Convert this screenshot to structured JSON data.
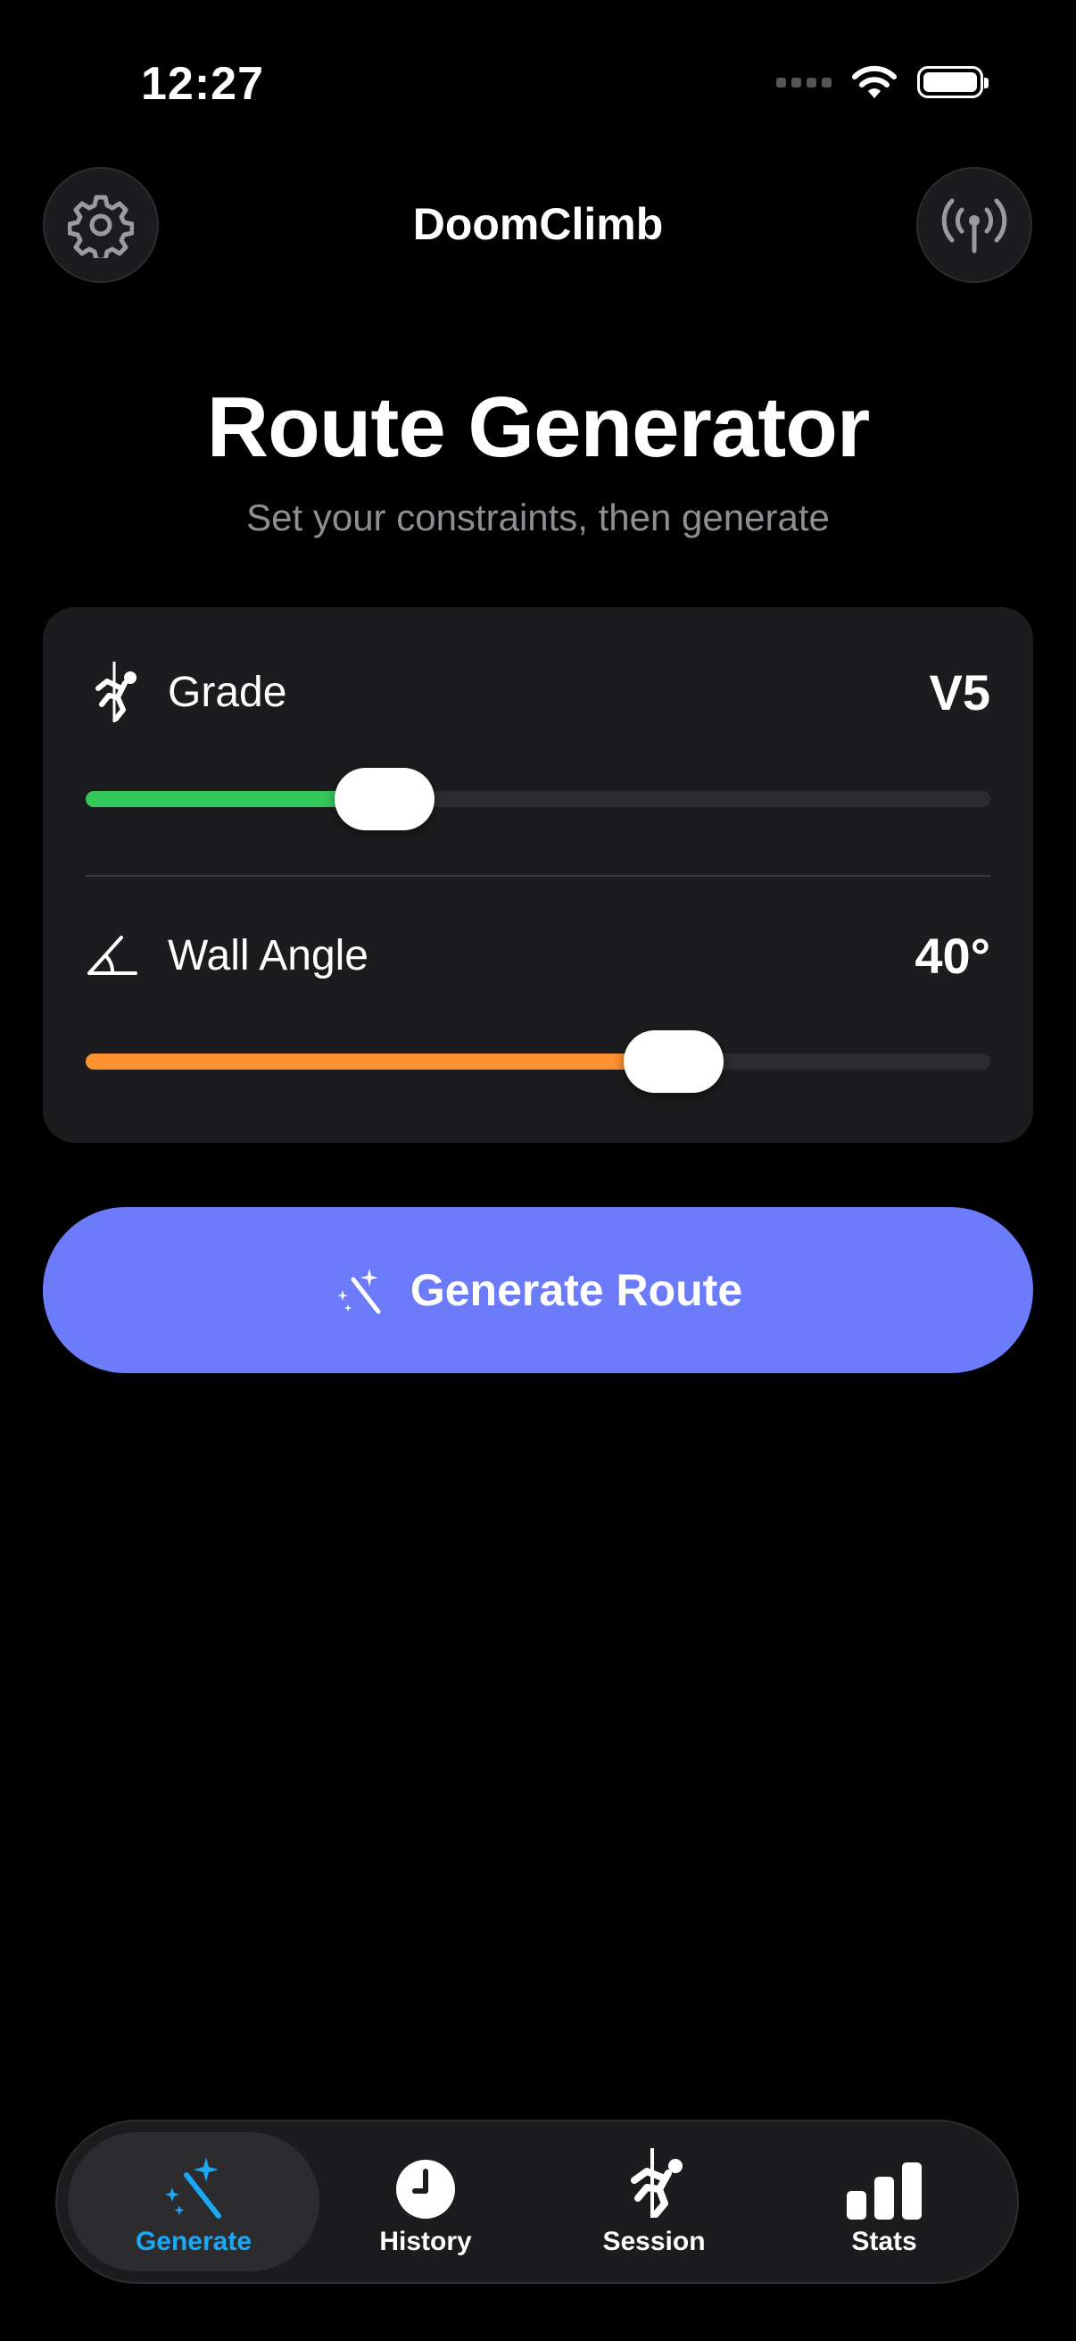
{
  "status_bar": {
    "time": "12:27"
  },
  "header": {
    "app_title": "DoomClimb",
    "settings_icon": "gear-icon",
    "live_icon": "antenna-icon"
  },
  "page": {
    "title": "Route Generator",
    "subtitle": "Set your constraints, then generate"
  },
  "constraints": {
    "grade": {
      "label": "Grade",
      "value": "V5",
      "slider_fraction": 0.33,
      "color": "#34c759"
    },
    "wall_angle": {
      "label": "Wall Angle",
      "value": "40°",
      "slider_fraction": 0.65,
      "color": "#ff9230"
    }
  },
  "generate_button": {
    "label": "Generate Route",
    "color": "#6b7bfa"
  },
  "tabs": [
    {
      "label": "Generate",
      "icon": "magic-wand-icon",
      "active": true
    },
    {
      "label": "History",
      "icon": "clock-icon",
      "active": false
    },
    {
      "label": "Session",
      "icon": "climber-icon",
      "active": false
    },
    {
      "label": "Stats",
      "icon": "bar-chart-icon",
      "active": false
    }
  ],
  "colors": {
    "accent_tab": "#1ba8f5",
    "background": "#000000",
    "card": "#1c1c1e"
  }
}
